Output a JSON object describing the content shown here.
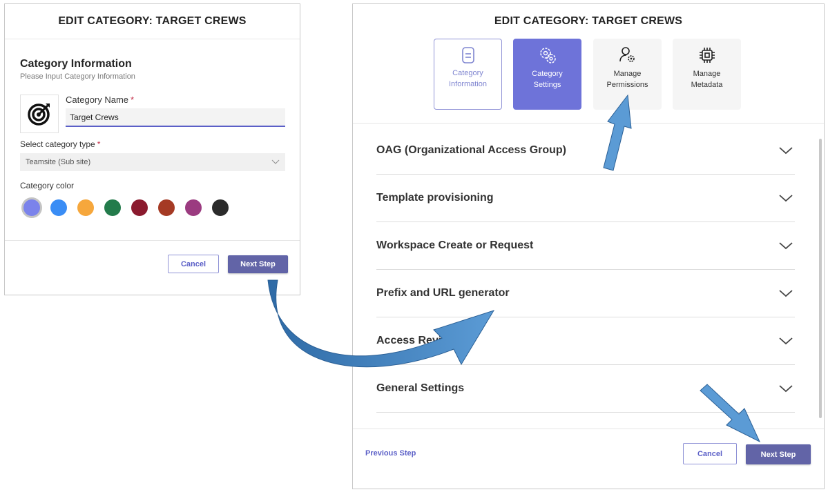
{
  "left_dialog": {
    "title": "EDIT CATEGORY: TARGET CREWS",
    "section_heading": "Category Information",
    "section_subheading": "Please Input Category Information",
    "icon": "target-icon",
    "name_label": "Category Name",
    "required_mark": "*",
    "name_value": "Target Crews",
    "type_label": "Select category type",
    "type_value": "Teamsite (Sub site)",
    "color_label": "Category color",
    "colors": [
      "#7b83eb",
      "#3a8df5",
      "#f6a73c",
      "#237b4b",
      "#8b1a2e",
      "#a53a24",
      "#9b3b80",
      "#2b2b2b"
    ],
    "selected_color_index": 0,
    "cancel_label": "Cancel",
    "next_label": "Next Step"
  },
  "right_dialog": {
    "title": "EDIT CATEGORY: TARGET CREWS",
    "tabs": [
      {
        "line1": "Category",
        "line2": "Information",
        "icon": "clipboard-icon"
      },
      {
        "line1": "Category",
        "line2": "Settings",
        "icon": "gear-cluster-icon"
      },
      {
        "line1": "Manage",
        "line2": "Permissions",
        "icon": "user-gear-icon"
      },
      {
        "line1": "Manage",
        "line2": "Metadata",
        "icon": "chip-icon"
      }
    ],
    "active_tab_index": 1,
    "sections": [
      "OAG (Organizational Access Group)",
      "Template provisioning",
      "Workspace Create or Request",
      "Prefix and URL generator",
      "Access Review",
      "General Settings"
    ],
    "previous_label": "Previous Step",
    "cancel_label": "Cancel",
    "next_label": "Next Step"
  },
  "colors": {
    "accent": "#6264a7",
    "arrow": "#5b9bd5"
  }
}
